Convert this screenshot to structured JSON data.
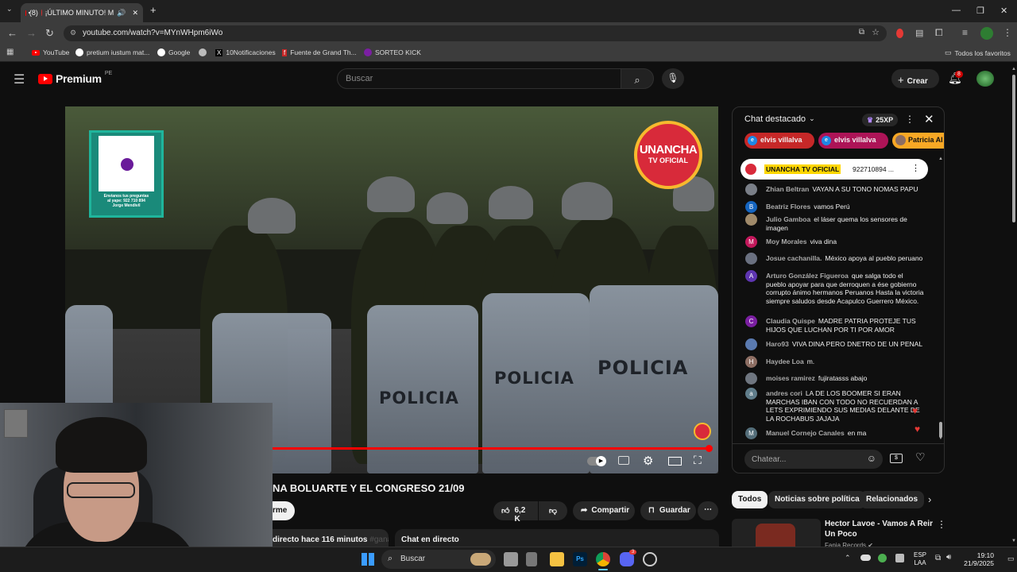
{
  "browser": {
    "tab_count_badge": "(8)",
    "tab_title": "¡ÚLTIMO MINUTO! M",
    "url": "youtube.com/watch?v=MYnWHpm6iWo",
    "bookmarks": [
      "YouTube",
      "pretium iustum mat...",
      "Google",
      "10Notificaciones",
      "Fuente de Grand Th...",
      "SORTEO KICK"
    ],
    "all_favorites": "Todos los favoritos"
  },
  "yt": {
    "brand": "Premium",
    "region": "PE",
    "search_placeholder": "Buscar",
    "create_label": "Crear",
    "notif_count": "8"
  },
  "video": {
    "shield_text": "POLICIA",
    "qr_caption_1": "Envíanos tus preguntas",
    "qr_caption_2": "al yape: 922 710 894",
    "qr_caption_3": "Jorge Mendivil",
    "logo_line1": "UNANCHA",
    "logo_line2": "TV OFICIAL",
    "title_fragment": "NA BOLUARTE Y EL CONGRESO 21/09"
  },
  "actions": {
    "subscribe_fragment": "rme",
    "likes": "6,2 K",
    "share": "Compartir",
    "save": "Guardar"
  },
  "description": {
    "meta": "directo hace 116 minutos",
    "hashtag": "#gana"
  },
  "live_chat_button": "Chat en directo",
  "chat": {
    "header": "Chat destacado",
    "xp": "25XP",
    "chips": [
      "elvis villalva",
      "elvis villalva",
      "Patricia Al"
    ],
    "pinned_author": "UNANCHA TV OFICIAL",
    "pinned_text": "922710894 ...",
    "messages": [
      {
        "author": "Zhian Beltran",
        "text": "VAYAN A SU TONO NOMAS PAPU",
        "initial": "",
        "color": "#7a7f88"
      },
      {
        "author": "Beatriz Flores",
        "text": "vamos Perú",
        "initial": "B",
        "color": "#1565c0"
      },
      {
        "author": "Julio Gamboa",
        "text": "el láser quema los sensores de imagen",
        "initial": "",
        "color": "#a08a6a"
      },
      {
        "author": "Moy Morales",
        "text": "viva dina",
        "initial": "M",
        "color": "#c2185b"
      },
      {
        "author": "Josue cachanilla.",
        "text": "México apoya al pueblo peruano",
        "initial": "",
        "color": "#6a7080"
      },
      {
        "author": "Arturo González Figueroa",
        "text": "que salga todo el pueblo apoyar para que derroquen a ése gobierno corrupto ánimo hermanos Peruanos Hasta la victoria siempre saludos desde Acapulco Guerrero México.",
        "initial": "A",
        "color": "#5e35b1"
      },
      {
        "author": "Claudia Quispe",
        "text": "MADRE PATRIA PROTEJE TUS HIJOS QUE LUCHAN POR TI POR AMOR",
        "initial": "C",
        "color": "#7b1fa2"
      },
      {
        "author": "Haro93",
        "text": "VIVA DINA PERO DNETRO DE UN PENAL",
        "initial": "",
        "color": "#5a7ab0"
      },
      {
        "author": "Haydee Loa",
        "text": "m.",
        "initial": "H",
        "color": "#8d6e63"
      },
      {
        "author": "moises ramirez",
        "text": "fujiratasss abajo",
        "initial": "",
        "color": "#6f7680"
      },
      {
        "author": "andres cori",
        "text": "LA DE LOS BOOMER SI ERAN MARCHAS IBAN CON TODO NO RECUERDAN A LETS EXPRIMIENDO SUS MEDIAS DELANTE DE LA ROCHABUS JAJAJA",
        "initial": "a",
        "color": "#607d8b"
      },
      {
        "author": "Manuel Cornejo Canales",
        "text": "en ma",
        "initial": "M",
        "color": "#546e7a"
      }
    ],
    "input_placeholder": "Chatear..."
  },
  "related": {
    "filters": [
      "Todos",
      "Noticias sobre política",
      "Relacionados"
    ],
    "first_title": "Hector Lavoe - Vamos A Reir Un Poco",
    "first_channel": "Fania Records"
  },
  "taskbar": {
    "search": "Buscar",
    "lang_1": "ESP",
    "lang_2": "LAA",
    "time": "19:10",
    "date": "21/9/2025",
    "discord_badge": "3"
  }
}
